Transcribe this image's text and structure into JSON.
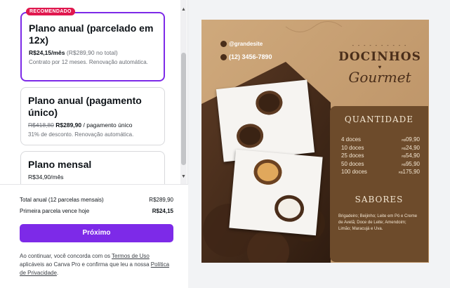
{
  "badge": "RECOMENDADO",
  "plans": [
    {
      "title": "Plano anual (parcelado em 12x)",
      "price_main": "R$24,15/mês",
      "price_extra": "(R$289,90 no total)",
      "note": "Contrato por 12 meses. Renovação automática."
    },
    {
      "title": "Plano anual (pagamento único)",
      "price_old": "R$418,80",
      "price_main": "R$289,90",
      "price_extra": "/ pagamento único",
      "note": "31% de desconto. Renovação automática."
    },
    {
      "title": "Plano mensal",
      "price_main": "R$34,90/mês"
    }
  ],
  "summary": {
    "row1_label": "Total anual (12 parcelas mensais)",
    "row1_value": "R$289,90",
    "row2_label": "Primeira parcela vence hoje",
    "row2_value": "R$24,15",
    "next_label": "Próximo",
    "legal_pre": "Ao continuar, você concorda com os ",
    "legal_link1": "Termos de Uso",
    "legal_mid": " aplicáveis ao Canva Pro e confirma que leu a nossa ",
    "legal_link2": "Política de Privacidade",
    "legal_end": "."
  },
  "preview": {
    "handle": "@grandesite",
    "phone": "(12) 3456-7890",
    "title_line1": "DOCINHOS",
    "title_line2": "Gourmet",
    "quantidade": "QUANTIDADE",
    "items": [
      {
        "qty": "4 doces",
        "price": "09,90"
      },
      {
        "qty": "10 doces",
        "price": "24,90"
      },
      {
        "qty": "25 doces",
        "price": "54,90"
      },
      {
        "qty": "50 doces",
        "price": "95,90"
      },
      {
        "qty": "100 doces",
        "price": "175,90"
      }
    ],
    "currency": "R$",
    "sabores": "SABORES",
    "flavors": "Brigadeiro; Beijinho; Leite em Pó e Creme de Avelã; Doce de Leite; Amendoim; Limão; Maracujá e Uva."
  },
  "colors": {
    "accent": "#7d2ae8",
    "badge": "#e0174e",
    "kraft": "#c9a47a",
    "menu_brown": "#6d4b2b"
  }
}
